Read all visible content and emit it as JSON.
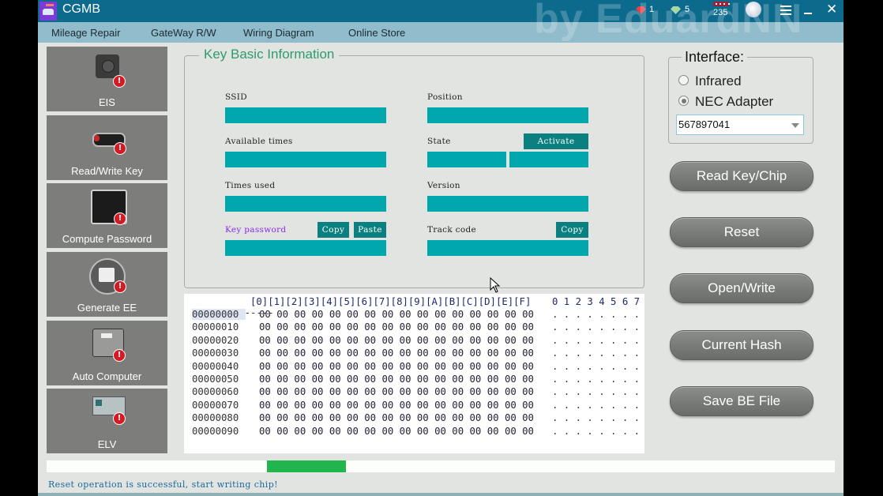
{
  "window": {
    "title": "CGMB",
    "watermark": "by EduardNN",
    "stats": {
      "red_gems": "1",
      "green_gems": "5",
      "coins": "235"
    },
    "icons": [
      "app-logo-icon",
      "red-gem-icon",
      "green-gem-icon",
      "coins-icon",
      "avatar-icon",
      "menu-icon",
      "minimize-icon",
      "close-icon"
    ],
    "close_glyph": "✕"
  },
  "menu": {
    "items": [
      {
        "label": "Mileage Repair"
      },
      {
        "label": "GateWay R/W"
      },
      {
        "label": "Wiring Diagram"
      },
      {
        "label": "Online Store"
      }
    ]
  },
  "sidebar": {
    "items": [
      {
        "label": "EIS",
        "icon": "ignition-switch-icon",
        "warning": "!"
      },
      {
        "label": "Read/Write Key",
        "icon": "car-key-icon",
        "warning": "!"
      },
      {
        "label": "Compute Password",
        "icon": "monitor-icon",
        "warning": "!"
      },
      {
        "label": "Generate EE",
        "icon": "printer-icon",
        "warning": "!"
      },
      {
        "label": "Auto Computer",
        "icon": "ecu-icon",
        "warning": "!"
      },
      {
        "label": "ELV",
        "icon": "circuit-board-icon",
        "warning": "!"
      }
    ]
  },
  "key_info": {
    "title": "Key Basic Information",
    "ssid": {
      "label": "SSID",
      "value": ""
    },
    "position": {
      "label": "Position",
      "value": ""
    },
    "available_times": {
      "label": "Available times",
      "value": ""
    },
    "state": {
      "label": "State",
      "value1": "",
      "value2": "",
      "activate_label": "Activate"
    },
    "times_used": {
      "label": "Times used",
      "value": ""
    },
    "version": {
      "label": "Version",
      "value": ""
    },
    "key_password": {
      "label": "Key password",
      "value": "",
      "copy_label": "Copy",
      "paste_label": "Paste"
    },
    "track_code": {
      "label": "Track code",
      "value": "",
      "copy_label": "Copy"
    }
  },
  "hex_view": {
    "header_addr": "--------",
    "header_cols": "[0][1][2][3][4][5][6][7][8][9][A][B][C][D][E][F]",
    "header_ascii": "0 1 2 3 4 5 6 7",
    "rows": [
      {
        "addr": "00000000",
        "bytes": "00 00 00 00 00 00 00 00 00 00 00 00 00 00 00 00",
        "ascii": ". . . . . . . ."
      },
      {
        "addr": "00000010",
        "bytes": "00 00 00 00 00 00 00 00 00 00 00 00 00 00 00 00",
        "ascii": ". . . . . . . ."
      },
      {
        "addr": "00000020",
        "bytes": "00 00 00 00 00 00 00 00 00 00 00 00 00 00 00 00",
        "ascii": ". . . . . . . ."
      },
      {
        "addr": "00000030",
        "bytes": "00 00 00 00 00 00 00 00 00 00 00 00 00 00 00 00",
        "ascii": ". . . . . . . ."
      },
      {
        "addr": "00000040",
        "bytes": "00 00 00 00 00 00 00 00 00 00 00 00 00 00 00 00",
        "ascii": ". . . . . . . ."
      },
      {
        "addr": "00000050",
        "bytes": "00 00 00 00 00 00 00 00 00 00 00 00 00 00 00 00",
        "ascii": ". . . . . . . ."
      },
      {
        "addr": "00000060",
        "bytes": "00 00 00 00 00 00 00 00 00 00 00 00 00 00 00 00",
        "ascii": ". . . . . . . ."
      },
      {
        "addr": "00000070",
        "bytes": "00 00 00 00 00 00 00 00 00 00 00 00 00 00 00 00",
        "ascii": ". . . . . . . ."
      },
      {
        "addr": "00000080",
        "bytes": "00 00 00 00 00 00 00 00 00 00 00 00 00 00 00 00",
        "ascii": ". . . . . . . ."
      },
      {
        "addr": "00000090",
        "bytes": "00 00 00 00 00 00 00 00 00 00 00 00 00 00 00 00",
        "ascii": ". . . . . . . ."
      }
    ],
    "selected_addr": "00000000"
  },
  "interface": {
    "title": "Interface:",
    "options": [
      {
        "label": "Infrared",
        "selected": false
      },
      {
        "label": "NEC Adapter",
        "selected": true
      }
    ],
    "device_id": "567897041"
  },
  "actions": [
    {
      "label": "Read Key/Chip"
    },
    {
      "label": "Reset"
    },
    {
      "label": "Open/Write"
    },
    {
      "label": "Current Hash"
    },
    {
      "label": "Save BE File"
    }
  ],
  "progress": {
    "segment_start_fraction": 0.28,
    "segment_end_fraction": 0.38,
    "color": "#22b54e"
  },
  "status": {
    "message": "Reset operation is successful, start writing chip!"
  },
  "colors": {
    "titlebar": "#0c6a8c",
    "menubar": "#90bccb",
    "field": "#00a8ad",
    "button_dark_teal": "#0a8180",
    "group_title": "#2e9b6e",
    "key_password_label": "#8a2be2"
  }
}
